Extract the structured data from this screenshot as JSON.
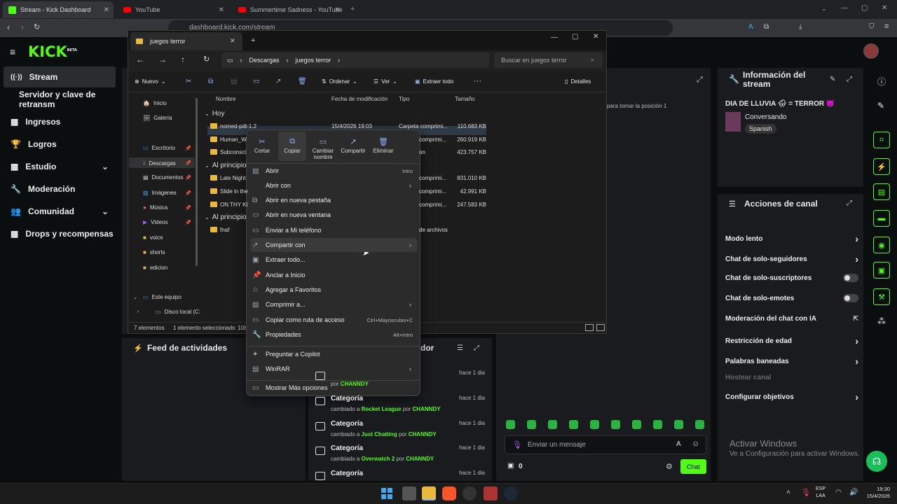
{
  "browser": {
    "tabs": [
      {
        "title": "Stream - Kick Dashboard"
      },
      {
        "title": "YouTube"
      },
      {
        "title": "Summertime Sadness - YouTube"
      }
    ],
    "url": "dashboard.kick.com/stream"
  },
  "kick": {
    "logo": "KICK",
    "beta": "BETA",
    "sidebar": [
      {
        "label": "Stream",
        "icon": "broadcast-icon"
      },
      {
        "label": "Servidor y clave de retransm"
      },
      {
        "label": "Ingresos",
        "icon": "grid-icon"
      },
      {
        "label": "Logros",
        "icon": "trophy-icon"
      },
      {
        "label": "Estudio",
        "icon": "grid-icon"
      },
      {
        "label": "Moderación",
        "icon": "wrench-icon"
      },
      {
        "label": "Comunidad",
        "icon": "people-icon"
      },
      {
        "label": "Drops y recompensas",
        "icon": "grid-icon"
      }
    ],
    "info": {
      "title": "Información del stream",
      "stream_title": "DIA DE LLUVIA 🌧 = TERROR 👿",
      "category": "Conversando",
      "language": "Spanish"
    },
    "actions": {
      "title": "Acciones de canal",
      "items": [
        {
          "label": "Modo lento",
          "control": "chevron"
        },
        {
          "label": "Chat de solo-seguidores",
          "control": "chevron"
        },
        {
          "label": "Chat de solo-suscriptores",
          "control": "toggle"
        },
        {
          "label": "Chat de solo-emotes",
          "control": "toggle"
        },
        {
          "label": "Moderación del chat con IA",
          "control": "external"
        },
        {
          "label": "Restricción de edad",
          "control": "chevron"
        },
        {
          "label": "Palabras baneadas",
          "control": "chevron"
        },
        {
          "label": "Hostear canal",
          "control": "none"
        },
        {
          "label": "Configurar objetivos",
          "control": "chevron"
        }
      ]
    },
    "feed_title": "Feed de actividades",
    "mod_title_partial": "dor",
    "queue_text": "para tomar la posición 1",
    "feed": [
      {
        "title": "",
        "sub_pre": "",
        "highlight": "",
        "sub_mid": "por",
        "user": "CHANNDY",
        "time": "hace 1 dia"
      },
      {
        "title": "Categoría",
        "sub_pre": "cambiado a",
        "highlight": "Rocket League",
        "sub_mid": "por",
        "user": "CHANNDY",
        "time": "hace 1 dia"
      },
      {
        "title": "Categoría",
        "sub_pre": "cambiado a",
        "highlight": "Just Chatting",
        "sub_mid": "por",
        "user": "CHANNDY",
        "time": "hace 1 dia"
      },
      {
        "title": "Categoría",
        "sub_pre": "cambiado a",
        "highlight": "Overwatch 2",
        "sub_mid": "por",
        "user": "CHANNDY",
        "time": "hace 1 dia"
      },
      {
        "title": "Categoría",
        "sub_pre": "",
        "highlight": "",
        "sub_mid": "",
        "user": "",
        "time": "hace 1 dia"
      }
    ],
    "chat": {
      "placeholder": "Enviar un mensaje",
      "count": "0",
      "send": "Chat"
    },
    "watermark": {
      "line1": "Activar Windows",
      "line2": "Ve a Configuración para activar Windows."
    }
  },
  "explorer": {
    "tab": "juegos terror",
    "breadcrumb": [
      "Descargas",
      "juegos terror"
    ],
    "search": "Buscar en juegos terror",
    "toolbar": {
      "new": "Nuevo",
      "sort": "Ordenar",
      "view": "Ver",
      "extract": "Extraer todo",
      "details": "Detalles"
    },
    "cols": [
      "Nombre",
      "Fecha de modificación",
      "Tipo",
      "Tamaño"
    ],
    "nav": [
      {
        "label": "Inicio"
      },
      {
        "label": "Galería"
      },
      {
        "label": "Escritorio"
      },
      {
        "label": "Descargas"
      },
      {
        "label": "Documentos"
      },
      {
        "label": "Imágenes"
      },
      {
        "label": "Música"
      },
      {
        "label": "Videos"
      },
      {
        "label": "voice"
      },
      {
        "label": "shorts"
      },
      {
        "label": "edicion"
      },
      {
        "label": "Este equipo"
      },
      {
        "label": "Disco local (C:"
      }
    ],
    "groups": [
      "Hoy",
      "Al principio",
      "Al principio"
    ],
    "files": [
      {
        "name": "nomed-pdt-1.2",
        "date": "15/4/2026 19:03",
        "type": "Carpeta comprimi...",
        "size": "110.683 KB"
      },
      {
        "name": "Human_W",
        "date": "",
        "type": "comprimi...",
        "size": "260.919 KB"
      },
      {
        "name": "Subconsci",
        "date": "",
        "type": "on",
        "size": "423.757 KB"
      },
      {
        "name": "Late Night",
        "date": "",
        "type": "comprimi...",
        "size": "831.010 KB"
      },
      {
        "name": "Slide in the",
        "date": "",
        "type": "comprimi...",
        "size": "42.991 KB"
      },
      {
        "name": "ON THY KI",
        "date": "",
        "type": "comprimi...",
        "size": "247.583 KB"
      },
      {
        "name": "fnaf",
        "date": "",
        "type": "de archivos",
        "size": ""
      }
    ],
    "status": {
      "count": "7 elementos",
      "sel": "1 elemento seleccionado",
      "size": "108"
    }
  },
  "context": {
    "quick": [
      {
        "label": "Cortar",
        "icon": "scissors-icon"
      },
      {
        "label": "Copiar",
        "icon": "copy-icon"
      },
      {
        "label": "Cambiar nombre",
        "icon": "rename-icon"
      },
      {
        "label": "Compartir",
        "icon": "share-icon"
      },
      {
        "label": "Eliminar",
        "icon": "trash-icon"
      }
    ],
    "items": [
      {
        "label": "Abrir",
        "key": "Intro",
        "arrow": false
      },
      {
        "label": "Abrir con",
        "key": "",
        "arrow": true
      },
      {
        "label": "Abrir en nueva pestaña",
        "key": "",
        "arrow": false
      },
      {
        "label": "Abrir en nueva ventana",
        "key": "",
        "arrow": false
      },
      {
        "label": "Enviar a Mi teléfono",
        "key": "",
        "arrow": false
      },
      {
        "label": "Compartir con",
        "key": "",
        "arrow": true
      },
      {
        "label": "Extraer todo...",
        "key": "",
        "arrow": false
      },
      {
        "label": "Anclar a Inicio",
        "key": "",
        "arrow": false
      },
      {
        "label": "Agregar a Favoritos",
        "key": "",
        "arrow": false
      },
      {
        "label": "Comprimir a...",
        "key": "",
        "arrow": true
      },
      {
        "label": "Copiar como ruta de acceso",
        "key": "Ctrl+Mayúsculas+C",
        "arrow": false
      },
      {
        "label": "Propiedades",
        "key": "Alt+Intro",
        "arrow": false
      },
      {
        "label": "Preguntar a Copilot",
        "key": "",
        "arrow": false
      },
      {
        "label": "WinRAR",
        "key": "",
        "arrow": true
      },
      {
        "label": "Mostrar Más opciones",
        "key": "",
        "arrow": false
      }
    ]
  },
  "taskbar": {
    "lang1": "ESP",
    "lang2": "LAA",
    "time": "19:30",
    "date": "15/4/2026"
  }
}
